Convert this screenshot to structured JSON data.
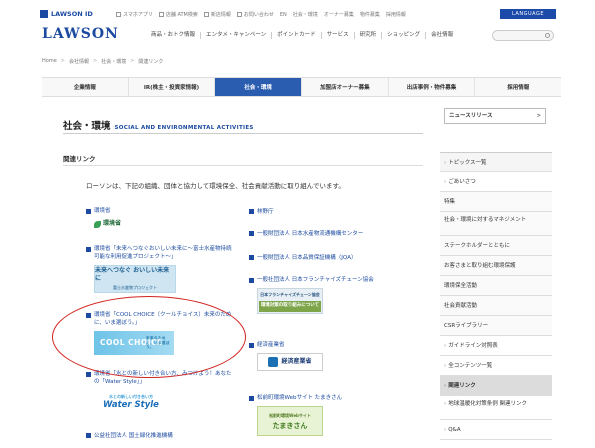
{
  "util": {
    "mini_logo": "LAWSON ID",
    "links": [
      "スマホアプリ",
      "店舗 ATM検索",
      "新店情報",
      "お問い合わせ",
      "EN",
      "社会・環境",
      "オーナー募集",
      "物件募集",
      "採用情報"
    ],
    "language": "LANGUAGE"
  },
  "header": {
    "logo": "LAWSON",
    "gnav": [
      "商品・おトク情報",
      "エンタメ・キャンペーン",
      "ポイントカード",
      "サービス",
      "研究所",
      "ショッピング",
      "会社情報"
    ]
  },
  "breadcrumb": [
    "Home",
    "会社情報",
    "社会・環境",
    "関連リンク"
  ],
  "tabs": [
    {
      "label": "企業情報",
      "active": false
    },
    {
      "label": "IR(株主・投資家情報)",
      "active": false
    },
    {
      "label": "社会・環境",
      "active": true
    },
    {
      "label": "加盟店オーナー募集",
      "active": false
    },
    {
      "label": "出店事例・物件募集",
      "active": false
    },
    {
      "label": "採用情報",
      "active": false
    }
  ],
  "section": {
    "title_jp": "社会・環境",
    "title_en": "SOCIAL AND ENVIRONMENTAL ACTIVITIES"
  },
  "news_select": "ニュースリリース",
  "page": {
    "heading": "関連リンク",
    "intro": "ローソンは、下記の組織、団体と協力して環境保全、社会貢献活動に取り組んでいます。"
  },
  "links_left": [
    {
      "title": "環境省",
      "banner": "環境省"
    },
    {
      "title": "環境省「未来へつなぐおいしい未来に〜富士水産物持続可能な利用促進プロジェクト〜」",
      "banner_main": "未来へつなぐ おいしい未来に",
      "banner_sub": "富士水産物プロジェクト"
    },
    {
      "title": "環境省「COOL CHOICE（クールチョイス）未来のために、いま選ぼう。」",
      "banner_main": "COOL CHOICE",
      "banner_sub": "未来のために、いま選ぼう。"
    },
    {
      "title": "環境省「水との新しい付き合い方、みつけよう！あなたの「Water Style」」",
      "banner_main": "Water Style",
      "banner_sub": "水との新しい付き合い方"
    },
    {
      "title": "公益社団法人 国土緑化推進機構"
    }
  ],
  "links_right": [
    {
      "title": "林野庁"
    },
    {
      "title": "一般財団法人 日本水産物流通機構センター"
    },
    {
      "title": "一般財団法人 日本品質保証機構（JQA）"
    },
    {
      "title": "一般社団法人 日本フランチャイズチェーン協会",
      "banner_main": "日本フランチャイズチェーン協会",
      "banner_sub": "環境対策の取り組みについて"
    },
    {
      "title": "経済産業省",
      "banner": "経済産業省"
    },
    {
      "title": "松前町環境Webサイト たまきさん",
      "banner_main": "松前町環境Webサイト",
      "banner_sub": "たまきさん"
    }
  ],
  "sidebar": [
    {
      "label": "トピックス一覧",
      "arrow": true
    },
    {
      "label": "ごあいさつ",
      "arrow": true
    },
    {
      "label": "特集",
      "arrow": false
    },
    {
      "label": "社会・環境に対するマネジメント",
      "arrow": false
    },
    {
      "label": "ステークホルダーとともに",
      "arrow": false
    },
    {
      "label": "お客さまと取り組む環境保護",
      "arrow": false
    },
    {
      "label": "環境保全活動",
      "arrow": false
    },
    {
      "label": "社会貢献活動",
      "arrow": false
    },
    {
      "label": "CSRライブラリー",
      "arrow": false
    },
    {
      "label": "ガイドライン対照表",
      "arrow": true
    },
    {
      "label": "全コンテンツ一覧",
      "arrow": true
    },
    {
      "label": "関連リンク",
      "arrow": true
    },
    {
      "label": "地球温暖化対策条例 関連リンク",
      "arrow": true
    },
    {
      "label": "Q&A",
      "arrow": true
    }
  ]
}
